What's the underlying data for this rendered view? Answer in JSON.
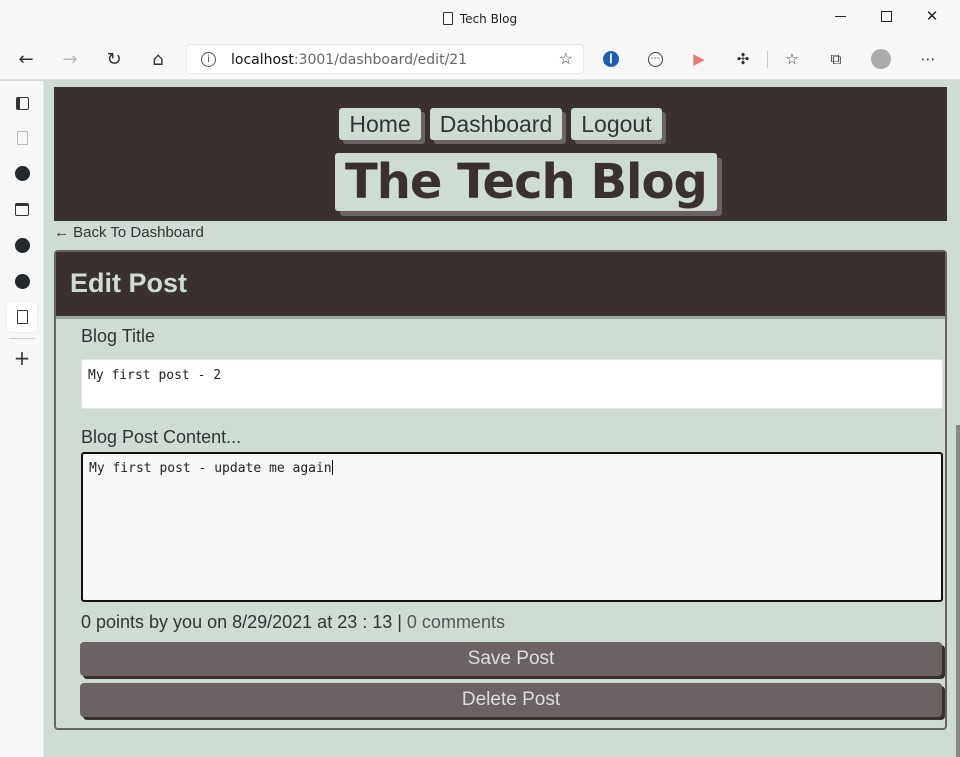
{
  "window": {
    "title": "Tech Blog"
  },
  "toolbar": {
    "url_host": "localhost",
    "url_rest": ":3001/dashboard/edit/21"
  },
  "site": {
    "nav": [
      "Home",
      "Dashboard",
      "Logout"
    ],
    "brand": "The Tech Blog",
    "back_link": "← Back To Dashboard"
  },
  "form": {
    "heading": "Edit Post",
    "title_label": "Blog Title",
    "title_value": "My first post - 2",
    "content_label": "Blog Post Content...",
    "content_value": "My first post - update me again",
    "meta_text": "0 points by you on 8/29/2021 at 23 : 13 | ",
    "comments_link": "0 comments",
    "save_label": "Save Post",
    "delete_label": "Delete Post"
  },
  "colors": {
    "dark": "#3a3030",
    "sage": "#cfdcd3",
    "button": "#6b6363"
  }
}
